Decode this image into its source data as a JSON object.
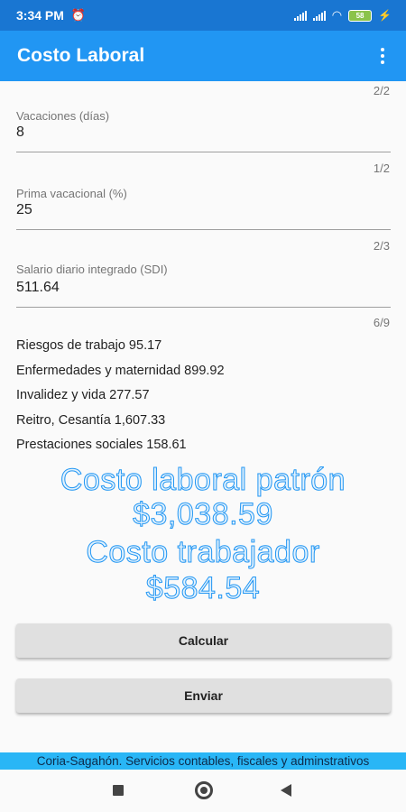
{
  "status_bar": {
    "time": "3:34 PM",
    "battery": "58"
  },
  "app_bar": {
    "title": "Costo Laboral"
  },
  "form": {
    "fields": [
      {
        "counter": "2/2",
        "label": "Vacaciones (días)",
        "value": "8"
      },
      {
        "counter": "1/2",
        "label": "Prima vacacional (%)",
        "value": "25"
      },
      {
        "counter": "2/3",
        "label": "Salario diario integrado (SDI)",
        "value": "511.64"
      }
    ],
    "results_counter": "6/9"
  },
  "results": [
    "Riesgos de trabajo 95.17",
    "Enfermedades y maternidad 899.92",
    "Invalidez y vida 277.57",
    "Reitro, Cesantía 1,607.33",
    "Prestaciones sociales 158.61"
  ],
  "summary": {
    "employer_label": "Costo laboral patrón",
    "employer_value": "$3,038.59",
    "worker_label": "Costo trabajador",
    "worker_value": "$584.54"
  },
  "buttons": {
    "calculate": "Calcular",
    "send": "Enviar"
  },
  "footer": {
    "text": "Coria-Sagahón. Servicios contables, fiscales y adminstrativos"
  },
  "colors": {
    "primary": "#2196f3",
    "primary_dark": "#1976d2",
    "footer": "#29b6f6"
  }
}
